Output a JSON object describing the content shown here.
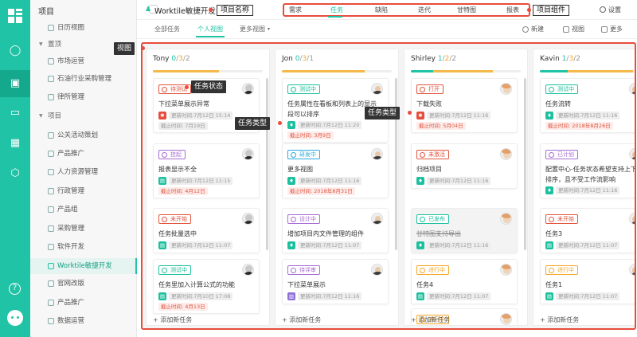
{
  "annotations": {
    "project_name": "项目名称",
    "project_components": "项目组件",
    "view": "视图",
    "task_status": "任务状态",
    "task_type_1": "任务类型",
    "task_type_2": "任务类型"
  },
  "sidebar": {
    "header": "项目",
    "items": [
      {
        "label": "日历视图",
        "type": "item"
      },
      {
        "label": "置顶",
        "type": "section"
      },
      {
        "label": "市场运营",
        "type": "item"
      },
      {
        "label": "石油行业采购管理",
        "type": "item"
      },
      {
        "label": "律所管理",
        "type": "item"
      },
      {
        "label": "项目",
        "type": "section"
      },
      {
        "label": "公关活动策划",
        "type": "item"
      },
      {
        "label": "产品推广",
        "type": "item"
      },
      {
        "label": "人力资源管理",
        "type": "item"
      },
      {
        "label": "行政管理",
        "type": "item"
      },
      {
        "label": "产品组",
        "type": "item"
      },
      {
        "label": "采购管理",
        "type": "item"
      },
      {
        "label": "软件开发",
        "type": "item"
      },
      {
        "label": "Worktile敏捷开发",
        "type": "item",
        "active": true
      },
      {
        "label": "官网改版",
        "type": "item"
      },
      {
        "label": "产品推广",
        "type": "item"
      },
      {
        "label": "数据运营",
        "type": "item"
      }
    ]
  },
  "header": {
    "project_name": "Worktile敏捷开发",
    "tabs": [
      "需求",
      "任务",
      "缺陷",
      "迭代",
      "甘特图",
      "报表"
    ],
    "active_tab": "任务",
    "settings": "设置"
  },
  "toolbar": {
    "views": [
      "全部任务",
      "个人视图",
      "更多视图"
    ],
    "active_view": "个人视图",
    "new": "新建",
    "view": "视图",
    "more": "更多"
  },
  "board": {
    "add_task": "添加新任务",
    "columns": [
      {
        "name": "Tony",
        "c1": "0",
        "c2": "3",
        "c3": "2",
        "progress": {
          "green": 0.0,
          "orange": 0.6
        },
        "cards": [
          {
            "status": "待测试",
            "status_color": "#e0533c",
            "title": "下拉菜单展示异常",
            "type_icon": "bug",
            "type_color": "#e74c3c",
            "updated": "更新时间:7月12日 15:14",
            "due": "截止时间: 7月19日",
            "due_style": "grey",
            "avatar": "man1"
          },
          {
            "status": "挂起",
            "status_color": "#a66bd3",
            "title": "报表显示不全",
            "type_icon": "doc",
            "type_color": "#1cc09f",
            "updated": "更新时间:7月12日 11:15",
            "due": "截止时间: 4月12日",
            "due_style": "red",
            "avatar": "man1"
          },
          {
            "status": "未开始",
            "status_color": "#e0533c",
            "title": "任务批量选中",
            "type_icon": "doc",
            "type_color": "#1cc09f",
            "updated": "更新时间:7月12日 11:07",
            "due": "",
            "due_style": "",
            "avatar": "man1"
          },
          {
            "status": "测试中",
            "status_color": "#1cc09f",
            "title": "任务里加入计算公式的功能",
            "type_icon": "doc",
            "type_color": "#1cc09f",
            "updated": "更新时间:7月10日 17:08",
            "due": "截止时间: 4月13日",
            "due_style": "red",
            "avatar": "man1"
          }
        ]
      },
      {
        "name": "Jon",
        "c1": "0",
        "c2": "3",
        "c3": "1",
        "progress": {
          "green": 0.0,
          "orange": 0.75
        },
        "cards": [
          {
            "status": "测试中",
            "status_color": "#1cc09f",
            "title": "任务属性在看板和列表上的显示段可以排序",
            "type_icon": "story",
            "type_color": "#1cc09f",
            "updated": "更新时间:7月12日 11:20",
            "due": "截止时间: 3月9日",
            "due_style": "red",
            "avatar": "man2"
          },
          {
            "status": "研发中",
            "status_color": "#2aa9e0",
            "title": "更多视图",
            "type_icon": "story",
            "type_color": "#1cc09f",
            "updated": "更新时间:7月12日 11:16",
            "due": "截止时间: 2018年8月31日",
            "due_style": "red",
            "avatar": "man2"
          },
          {
            "status": "设计中",
            "status_color": "#a66bd3",
            "title": "增加项目内文件管理的组件",
            "type_icon": "story",
            "type_color": "#1cc09f",
            "updated": "更新时间:7月12日 11:07",
            "due": "",
            "due_style": "",
            "avatar": "man2"
          },
          {
            "status": "待评审",
            "status_color": "#a66bd3",
            "title": "下拉菜单展示",
            "type_icon": "task",
            "type_color": "#8e6fd6",
            "updated": "更新时间:7月12日 11:16",
            "due": "",
            "due_style": "",
            "avatar": "man2"
          }
        ]
      },
      {
        "name": "Shirley",
        "c1": "1",
        "c2": "2",
        "c3": "2",
        "progress": {
          "green": 0.2,
          "orange": 0.55
        },
        "cards": [
          {
            "status": "打开",
            "status_color": "#e0533c",
            "title": "下载失败",
            "type_icon": "bug",
            "type_color": "#e74c3c",
            "updated": "更新时间:7月12日 11:16",
            "due": "截止时间: 5月04日",
            "due_style": "red",
            "avatar": "woman"
          },
          {
            "status": "未激活",
            "status_color": "#e0533c",
            "title": "归档项目",
            "type_icon": "story",
            "type_color": "#1cc09f",
            "updated": "更新时间:7月12日 11:16",
            "due": "",
            "due_style": "",
            "avatar": "woman"
          },
          {
            "status": "已发布",
            "status_color": "#1cc09f",
            "title": "甘特图支持导出",
            "type_icon": "story",
            "type_color": "#1cc09f",
            "updated": "更新时间:7月12日 11:16",
            "due": "",
            "due_style": "",
            "avatar": "woman",
            "done": true
          },
          {
            "status": "进行中",
            "status_color": "#f5a623",
            "title": "任务4",
            "type_icon": "doc",
            "type_color": "#1cc09f",
            "updated": "更新时间:7月12日 11:07",
            "due": "",
            "due_style": "",
            "avatar": "woman"
          },
          {
            "status": "进行中",
            "status_color": "#f5a623",
            "title": "",
            "type_icon": "",
            "type_color": "",
            "updated": "",
            "due": "",
            "due_style": "",
            "avatar": "woman"
          }
        ]
      },
      {
        "name": "Kavin",
        "c1": "1",
        "c2": "3",
        "c3": "2",
        "progress": {
          "green": 0.25,
          "orange": 0.6
        },
        "cards": [
          {
            "status": "测试中",
            "status_color": "#1cc09f",
            "title": "任务流转",
            "type_icon": "story",
            "type_color": "#1cc09f",
            "updated": "更新时间:7月12日 11:16",
            "due": "截止时间: 2018年8月26日",
            "due_style": "red",
            "avatar": "man3"
          },
          {
            "status": "已计划",
            "status_color": "#a66bd3",
            "title": "配置中心-任务状态希望支持上下排序，且不受工作流影响",
            "type_icon": "story",
            "type_color": "#1cc09f",
            "updated": "更新时间:7月12日 11:16",
            "due": "",
            "due_style": "",
            "avatar": "man3"
          },
          {
            "status": "未开始",
            "status_color": "#e0533c",
            "title": "任务3",
            "type_icon": "doc",
            "type_color": "#1cc09f",
            "updated": "更新时间:7月12日 11:07",
            "due": "",
            "due_style": "",
            "avatar": "man3"
          },
          {
            "status": "进行中",
            "status_color": "#f5a623",
            "title": "任务1",
            "type_icon": "doc",
            "type_color": "#1cc09f",
            "updated": "更新时间:7月12日 11:07",
            "due": "",
            "due_style": "",
            "avatar": "man3"
          }
        ]
      }
    ]
  },
  "colors": {
    "brand": "#20c3a5",
    "highlight": "#e74c3c",
    "progress_green": "#20c3a5",
    "progress_orange": "#f5b84a"
  }
}
